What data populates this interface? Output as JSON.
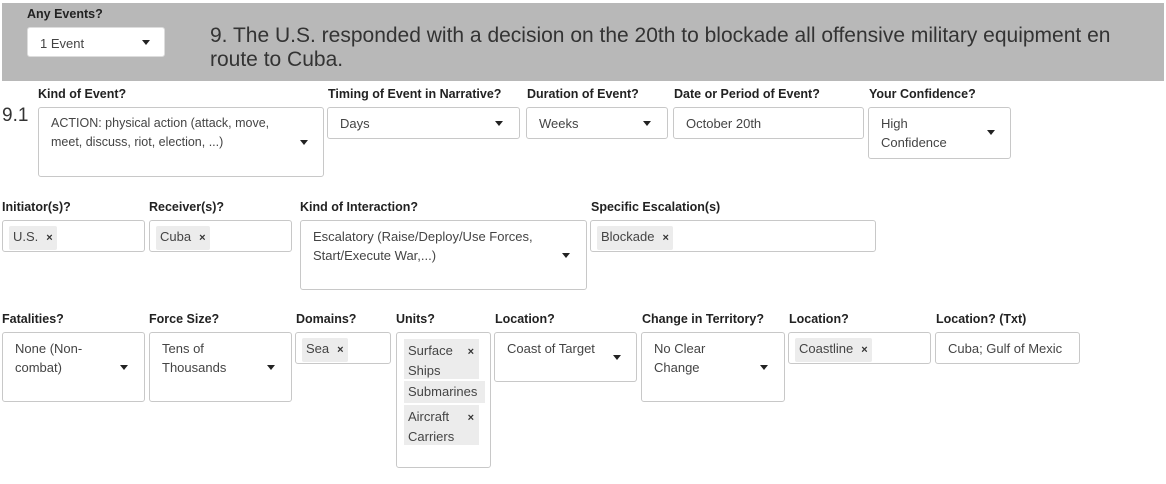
{
  "header": {
    "any_events_label": "Any Events?",
    "any_events_value": "1 Event",
    "narrative_text": "9. The U.S. responded with a decision on the 20th to blockade all offensive military equipment en route to Cuba."
  },
  "event_number": "9.1",
  "row1": {
    "kind_label": "Kind of Event?",
    "kind_value": "ACTION: physical action (attack, move, meet, discuss, riot, election, ...)",
    "timing_label": "Timing of Event in Narrative?",
    "timing_value": "Days",
    "duration_label": "Duration of Event?",
    "duration_value": "Weeks",
    "date_label": "Date or Period of Event?",
    "date_value": "October 20th",
    "confidence_label": "Your Confidence?",
    "confidence_value": "High Confidence"
  },
  "row2": {
    "initiator_label": "Initiator(s)?",
    "initiator_tag": "U.S.",
    "receiver_label": "Receiver(s)?",
    "receiver_tag": "Cuba",
    "interaction_label": "Kind of Interaction?",
    "interaction_value": "Escalatory (Raise/Deploy/Use Forces, Start/Execute War,...)",
    "escalation_label": "Specific Escalation(s)",
    "escalation_tag": "Blockade"
  },
  "row3": {
    "fatalities_label": "Fatalities?",
    "fatalities_value": "None (Non-combat)",
    "force_label": "Force Size?",
    "force_value": "Tens of Thousands",
    "domains_label": "Domains?",
    "domains_tag": "Sea",
    "units_label": "Units?",
    "units_tags": [
      "Surface Ships",
      "Submarines",
      "Aircraft Carriers"
    ],
    "location_label": "Location?",
    "location_value": "Coast of Target",
    "territory_label": "Change in Territory?",
    "territory_value": "No Clear Change",
    "location2_label": "Location?",
    "location2_tag": "Coastline",
    "location_txt_label": "Location? (Txt)",
    "location_txt_value": "Cuba; Gulf of Mexic"
  },
  "remove_glyph": "×"
}
